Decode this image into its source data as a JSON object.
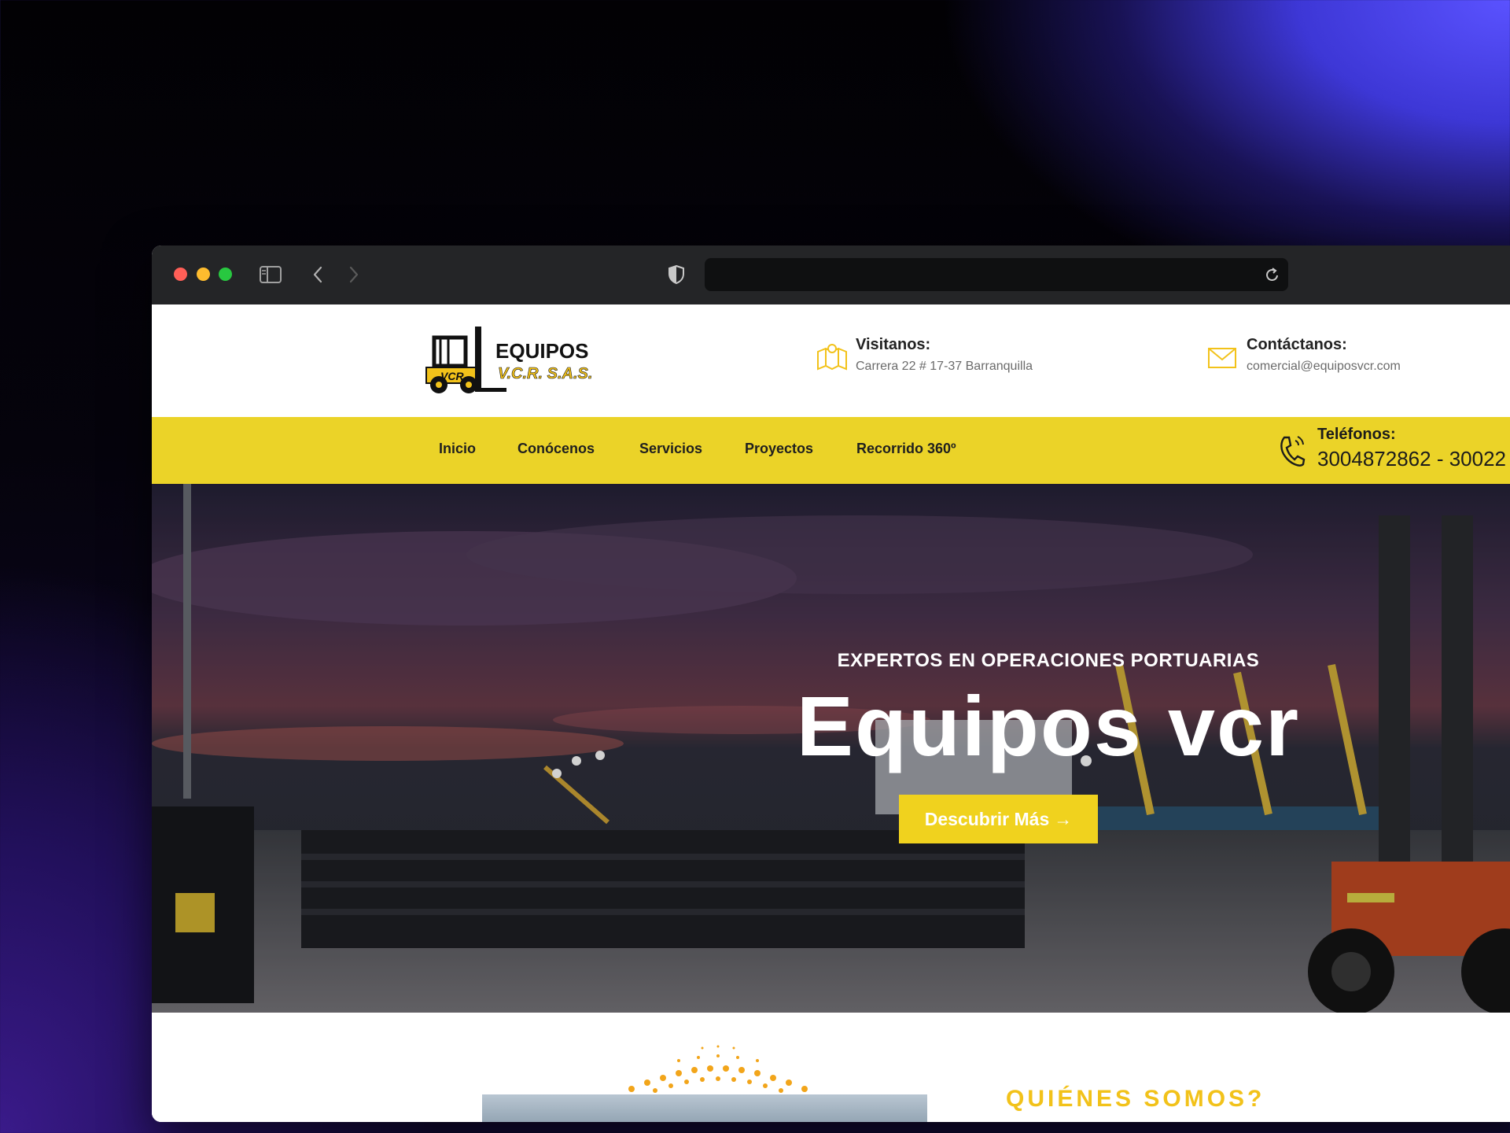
{
  "browser": {
    "url": ""
  },
  "header": {
    "logo_text": "EQUIPOS",
    "logo_sub": "V.C.R. S.A.S.",
    "logo_badge": "VCR",
    "visit": {
      "title": "Visitanos:",
      "value": "Carrera 22 # 17-37 Barranquilla"
    },
    "contact": {
      "title": "Contáctanos:",
      "value": "comercial@equiposvcr.com"
    }
  },
  "nav": {
    "items": [
      "Inicio",
      "Conócenos",
      "Servicios",
      "Proyectos",
      "Recorrido 360º"
    ],
    "phone_title": "Teléfonos:",
    "phone_value": "3004872862 - 30022"
  },
  "hero": {
    "subtitle": "EXPERTOS EN OPERACIONES PORTUARIAS",
    "title": "Equipos vcr",
    "button": "Descubrir Más",
    "button_arrow": "→"
  },
  "about": {
    "title": "QUIÉNES SOMOS?"
  },
  "colors": {
    "accent_yellow": "#ebd328",
    "button_yellow": "#f0d21e",
    "title_yellow": "#f2c21a"
  }
}
